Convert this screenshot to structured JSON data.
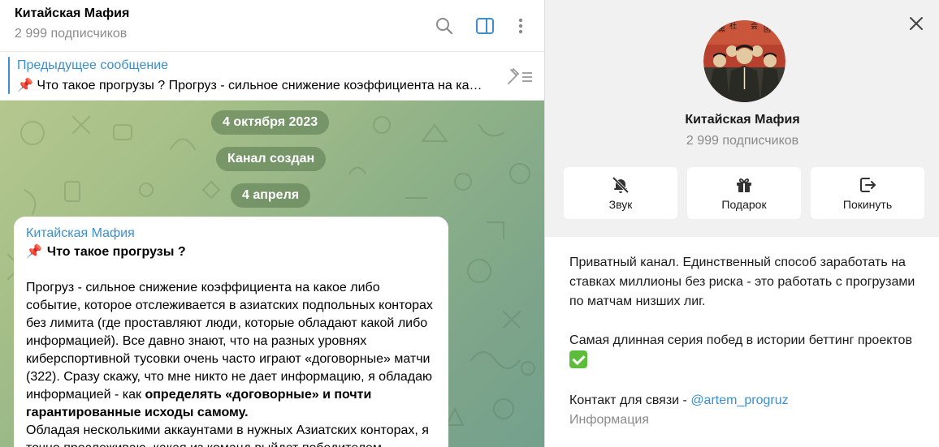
{
  "chat": {
    "title": "Китайская Мафия",
    "subscribers": "2 999 подписчиков",
    "header_icons": [
      "search-icon",
      "sidebar-toggle-icon",
      "more-vertical-icon"
    ],
    "pinned": {
      "title": "Предыдущее сообщение",
      "text": "📌 Что такое прогрузы ?  Прогруз - сильное снижение коэффициента на какое либо событие"
    },
    "dates": {
      "first": "4 октября 2023",
      "service": "Канал создан",
      "second": "4 апреля"
    },
    "message": {
      "author": "Китайская Мафия",
      "heading": "Что такое прогрузы ?",
      "p1": "Прогруз - сильное снижение коэффициента на какое либо событие, которое отслеживается в азиатских подпольных конторах без лимита (где проставляют люди, которые обладают какой либо информацией). Все давно знают, что на разных уровнях киберспортивной тусовки очень часто играют «договорные» матчи (322). Сразу скажу, что мне никто не дает информацию, я обладаю информацией - как ",
      "p1_bold": "определять «договорные» и почти гарантированные исходы самому.",
      "p2": "Обладая несколькими аккаунтами в нужных Азиатских конторах, я точно прослеживаю, какая из команд выйдет победителем."
    }
  },
  "profile": {
    "name": "Китайская Мафия",
    "subscribers": "2 999 подписчиков",
    "actions": [
      {
        "label": "Звук",
        "icon": "bell-off-icon"
      },
      {
        "label": "Подарок",
        "icon": "gift-icon"
      },
      {
        "label": "Покинуть",
        "icon": "leave-icon"
      }
    ],
    "description_1": "Приватный канал. Единственный способ заработать на ставках миллионы без риска - это работать с прогрузами по матчам низших лиг.",
    "description_2": "Самая длинная серия побед в истории беттинг проектов",
    "contact_prefix": "Контакт для связи - ",
    "contact_link": "@artem_progruz",
    "info_label": "Информация"
  },
  "colors": {
    "accent": "#3a8fd1",
    "muted": "#8a8a8a",
    "pill": "#608054",
    "checkmark": "#5bbd3a"
  }
}
